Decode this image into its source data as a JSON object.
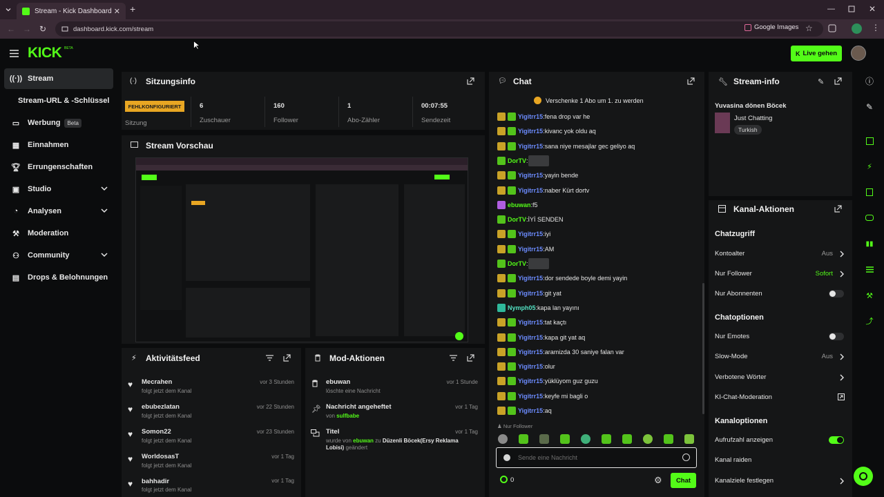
{
  "browser": {
    "tab_title": "Stream - Kick Dashboard",
    "url": "dashboard.kick.com/stream",
    "google_images": "Google Images"
  },
  "app": {
    "logo": "KICK",
    "logo_sup": "BETA",
    "live_button": "Live gehen"
  },
  "sidebar": {
    "items": [
      {
        "label": "Stream",
        "icon": "broadcast-icon"
      },
      {
        "label": "Stream-URL & -Schlüssel",
        "icon": ""
      },
      {
        "label": "Werbung",
        "icon": "ad-icon",
        "badge": "Beta"
      },
      {
        "label": "Einnahmen",
        "icon": "chart-icon"
      },
      {
        "label": "Errungenschaften",
        "icon": "trophy-icon"
      },
      {
        "label": "Studio",
        "icon": "studio-icon"
      },
      {
        "label": "Analysen",
        "icon": "analytics-icon"
      },
      {
        "label": "Moderation",
        "icon": "hammer-icon"
      },
      {
        "label": "Community",
        "icon": "community-icon"
      },
      {
        "label": "Drops & Belohnungen",
        "icon": "gift-icon"
      }
    ]
  },
  "session": {
    "title": "Sitzungsinfo",
    "status": "FEHLKONFIGURIERT",
    "status_label": "Sitzung",
    "viewers_value": "6",
    "viewers_label": "Zuschauer",
    "followers_value": "160",
    "followers_label": "Follower",
    "subs_value": "1",
    "subs_label": "Abo-Zähler",
    "time_value": "00:07:55",
    "time_label": "Sendezeit"
  },
  "preview": {
    "title": "Stream Vorschau"
  },
  "activity": {
    "title": "Aktivitätsfeed",
    "items": [
      {
        "name": "Mecrahen",
        "sub": "folgt jetzt dem Kanal",
        "time": "vor 3 Stunden"
      },
      {
        "name": "ebubezlatan",
        "sub": "folgt jetzt dem Kanal",
        "time": "vor 22 Stunden"
      },
      {
        "name": "Somon22",
        "sub": "folgt jetzt dem Kanal",
        "time": "vor 23 Stunden"
      },
      {
        "name": "WorldosasT",
        "sub": "folgt jetzt dem Kanal",
        "time": "vor 1 Tag"
      },
      {
        "name": "bahhadir",
        "sub": "folgt jetzt dem Kanal",
        "time": "vor 1 Tag"
      }
    ]
  },
  "mod": {
    "title": "Mod-Aktionen",
    "items": [
      {
        "name": "ebuwan",
        "sub": "löschte eine Nachricht",
        "time": "vor 1 Stunde"
      },
      {
        "name": "Nachricht angeheftet",
        "sub_pre": "von",
        "sub_user": "sulfbabe",
        "time": "vor 1 Tag"
      },
      {
        "name": "Titel",
        "sub_pre": "wurde von",
        "sub_user": "ebuwan",
        "sub_mid": "zu",
        "sub_title": "Düzenli Böcek(Ersy Reklama Lobisi)",
        "sub_post": "geändert",
        "time": "vor 1 Tag"
      }
    ]
  },
  "chat": {
    "title": "Chat",
    "promo": "Verschenke 1 Abo um 1. zu werden",
    "messages": [
      {
        "user": "Yigitrr15",
        "text": "fena drop var he",
        "ucls": "u-blue",
        "badges": "yg"
      },
      {
        "user": "Yigitrr15",
        "text": "kivanc yok oldu aq",
        "ucls": "u-blue",
        "badges": "yg"
      },
      {
        "user": "Yigitrr15",
        "text": "sana niye mesajlar gec geliyo aq",
        "ucls": "u-blue",
        "badges": "yg"
      },
      {
        "user": "DorTV",
        "text": "",
        "ucls": "u-green",
        "badges": "g",
        "emote": true
      },
      {
        "user": "Yigitrr15",
        "text": "yayin bende",
        "ucls": "u-blue",
        "badges": "yg"
      },
      {
        "user": "Yigitrr15",
        "text": "naber Kürt dortv",
        "ucls": "u-blue",
        "badges": "yg"
      },
      {
        "user": "ebuwan",
        "text": "f5",
        "ucls": "u-green",
        "badges": "p"
      },
      {
        "user": "DorTV",
        "text": "İYİ SENDEN",
        "ucls": "u-green",
        "badges": "g"
      },
      {
        "user": "Yigitrr15",
        "text": "iyi",
        "ucls": "u-blue",
        "badges": "yg"
      },
      {
        "user": "Yigitrr15",
        "text": "AM",
        "ucls": "u-blue",
        "badges": "yg"
      },
      {
        "user": "DorTV",
        "text": "",
        "ucls": "u-green",
        "badges": "g",
        "emote": true
      },
      {
        "user": "Yigitrr15",
        "text": "dor sendede boyle demi yayin",
        "ucls": "u-blue",
        "badges": "yg"
      },
      {
        "user": "Yigitrr15",
        "text": "git yat",
        "ucls": "u-blue",
        "badges": "yg"
      },
      {
        "user": "Nymph05",
        "text": "kapa lan yayını",
        "ucls": "u-teal",
        "badges": "t"
      },
      {
        "user": "Yigitrr15",
        "text": "tat kaçtı",
        "ucls": "u-blue",
        "badges": "yg"
      },
      {
        "user": "Yigitrr15",
        "text": "kapa git yat aq",
        "ucls": "u-blue",
        "badges": "yg"
      },
      {
        "user": "Yigitrr15",
        "text": "aramizda 30 saniye falan var",
        "ucls": "u-blue",
        "badges": "yg"
      },
      {
        "user": "Yigitrr15",
        "text": "olur",
        "ucls": "u-blue",
        "badges": "yg"
      },
      {
        "user": "Yigitrr15",
        "text": "yüklüyom guz guzu",
        "ucls": "u-blue",
        "badges": "yg"
      },
      {
        "user": "Yigitrr15",
        "text": "keyfe mi bagli o",
        "ucls": "u-blue",
        "badges": "yg"
      },
      {
        "user": "Yigitrr15",
        "text": "aq",
        "ucls": "u-blue",
        "badges": "yg"
      }
    ],
    "followers_only": "Nur Follower",
    "input_placeholder": "Sende eine Nachricht",
    "count": "0",
    "send": "Chat"
  },
  "stream_info": {
    "title": "Stream-info",
    "stream_title": "Yuvasina dönen Böcek",
    "category": "Just Chatting",
    "tag": "Turkish"
  },
  "channel_actions": {
    "title": "Kanal-Aktionen",
    "section_access": "Chatzugriff",
    "account_age": "Kontoalter",
    "account_age_val": "Aus",
    "followers_only": "Nur Follower",
    "followers_only_val": "Sofort",
    "subs_only": "Nur Abonnenten",
    "section_options": "Chatoptionen",
    "emotes_only": "Nur Emotes",
    "slow_mode": "Slow-Mode",
    "slow_mode_val": "Aus",
    "banned_words": "Verbotene Wörter",
    "ai_moderation": "KI-Chat-Moderation",
    "section_channel": "Kanaloptionen",
    "show_viewers": "Aufrufzahl anzeigen",
    "raid": "Kanal raiden",
    "goals": "Kanalziele festlegen"
  },
  "colors": {
    "accent": "#53fc18",
    "bg": "#0b0c0d",
    "panel": "#151617"
  }
}
